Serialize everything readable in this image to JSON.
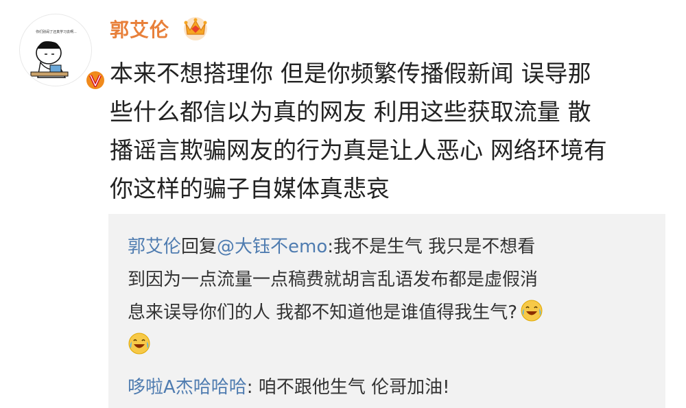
{
  "post": {
    "author": "郭艾伦",
    "avatar_caption": "你们别闹了还真学习去啊...",
    "lines": [
      "本来不想搭理你 但是你频繁传播假新闻 误导那",
      "些什么都信以为真的网友 利用这些获取流量 散",
      "播谣言欺骗网友的行为真是让人恶心 网络环境有",
      "你这样的骗子自媒体真悲哀"
    ]
  },
  "reply": {
    "author": "郭艾伦",
    "verb": "回复",
    "mention": "@大钰不emo",
    "line1_text": ":我不是生气 我只是不想看",
    "line2_text": "到因为一点流量一点稿费就胡言乱语发布都是虚假消",
    "line3_text": "息来误导你们的人 我都不知道他是谁值得我生气?",
    "emoji": "laugh-cry"
  },
  "comment": {
    "author": "哆啦A杰哈哈哈",
    "text": ": 咱不跟他生气  伦哥加油!"
  },
  "colors": {
    "name_orange": "#e8803a",
    "link_blue": "#4f7cb0",
    "reply_bg": "#f2f2f2",
    "badge_orange": "#f08a1c"
  }
}
